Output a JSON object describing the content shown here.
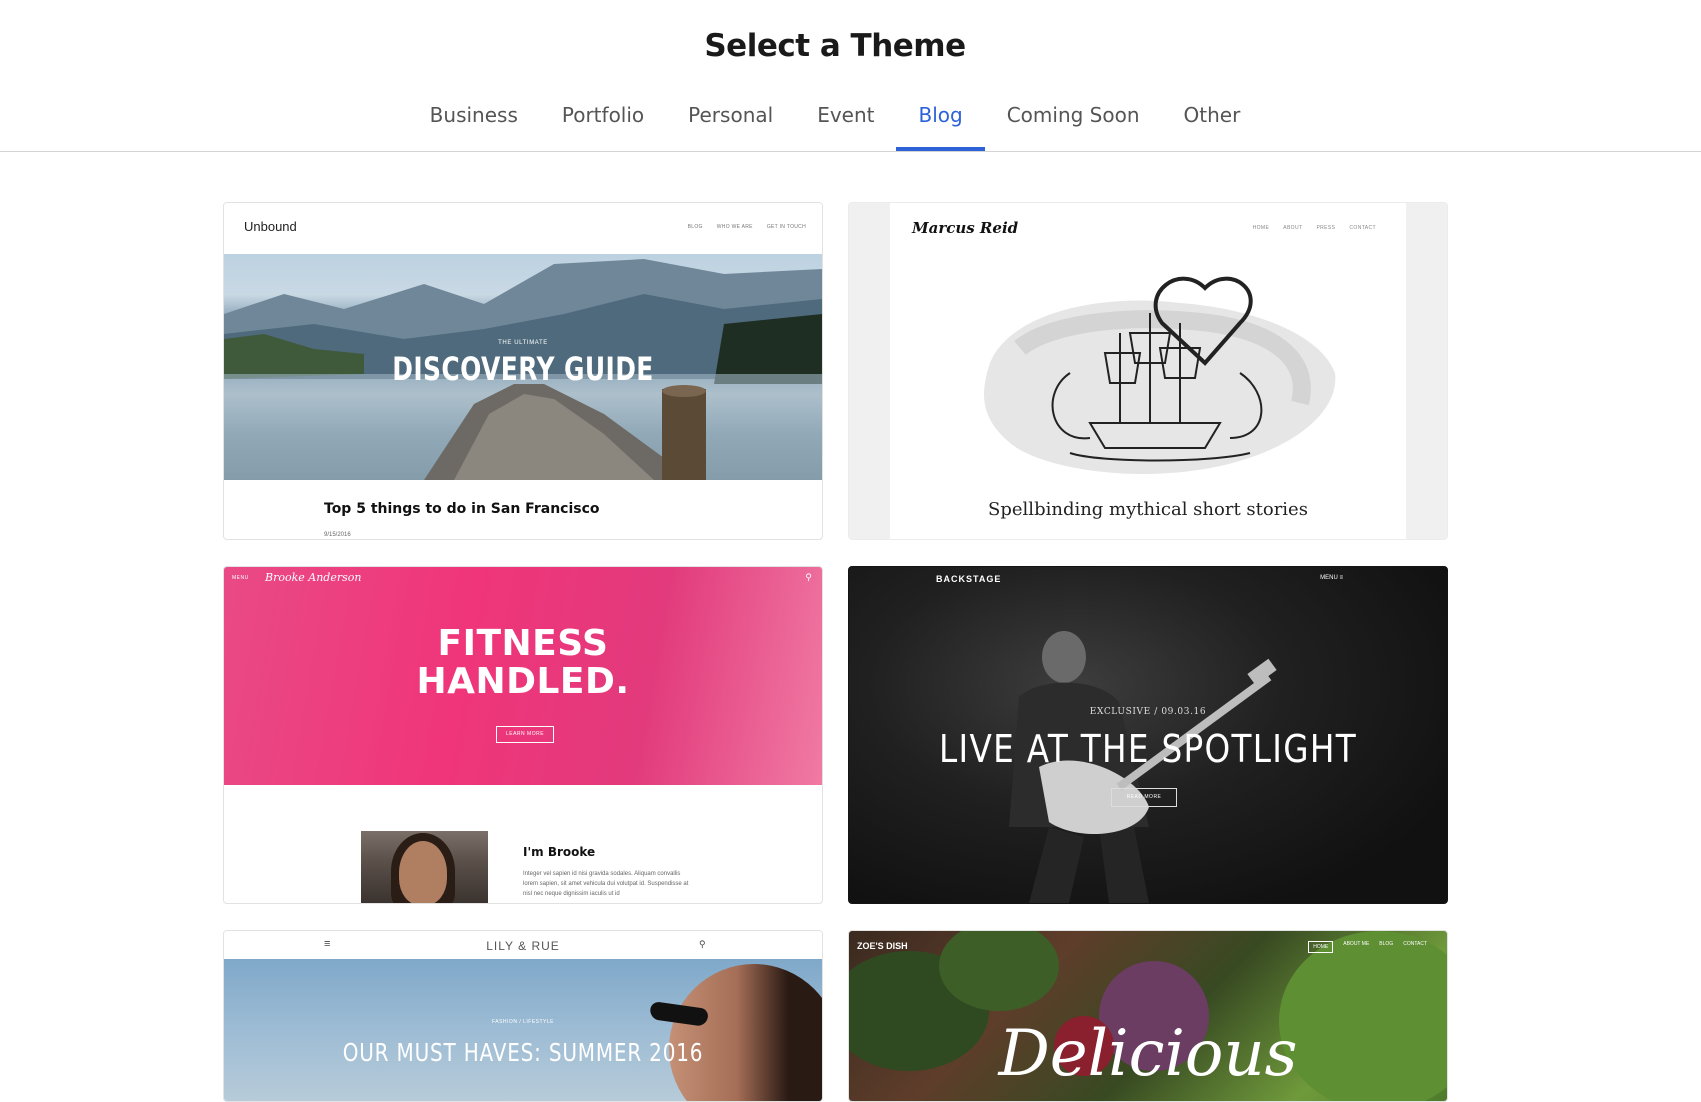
{
  "page": {
    "title": "Select a Theme"
  },
  "tabs": [
    {
      "label": "Business"
    },
    {
      "label": "Portfolio"
    },
    {
      "label": "Personal"
    },
    {
      "label": "Event"
    },
    {
      "label": "Blog",
      "active": true
    },
    {
      "label": "Coming Soon"
    },
    {
      "label": "Other"
    }
  ],
  "accent_color": "#2d62d8",
  "themes": {
    "unbound": {
      "logo": "Unbound",
      "nav": [
        "BLOG",
        "WHO WE ARE",
        "GET IN TOUCH"
      ],
      "kicker": "THE ULTIMATE",
      "headline": "DISCOVERY GUIDE",
      "post_title": "Top 5 things to do in San Francisco",
      "post_date": "9/15/2016"
    },
    "marcus_reid": {
      "logo": "Marcus Reid",
      "nav": [
        "HOME",
        "ABOUT",
        "PRESS",
        "CONTACT"
      ],
      "caption": "Spellbinding mythical short stories"
    },
    "brooke": {
      "menu": "MENU",
      "logo": "Brooke Anderson",
      "headline_1": "FITNESS",
      "headline_2": "HANDLED.",
      "button": "LEARN MORE",
      "about_title": "I'm Brooke",
      "about_text": "Integer vel sapien id nisi gravida sodales. Aliquam convallis lorem sapien, sit amet vehicula dui volutpat id. Suspendisse at nisl nec neque dignissim iaculis ut id"
    },
    "backstage": {
      "logo": "BACKSTAGE",
      "menu": "MENU ≡",
      "kicker": "EXCLUSIVE / 09.03.16",
      "headline": "LIVE AT THE SPOTLIGHT",
      "button": "READ MORE"
    },
    "lily_rue": {
      "logo": "LILY & RUE",
      "kicker": "FASHION / LIFESTYLE",
      "headline": "OUR MUST HAVES: SUMMER 2016"
    },
    "zoes_dish": {
      "logo": "ZOE'S DISH",
      "nav": [
        "HOME",
        "ABOUT ME",
        "BLOG",
        "CONTACT"
      ],
      "headline": "Delicious"
    }
  }
}
